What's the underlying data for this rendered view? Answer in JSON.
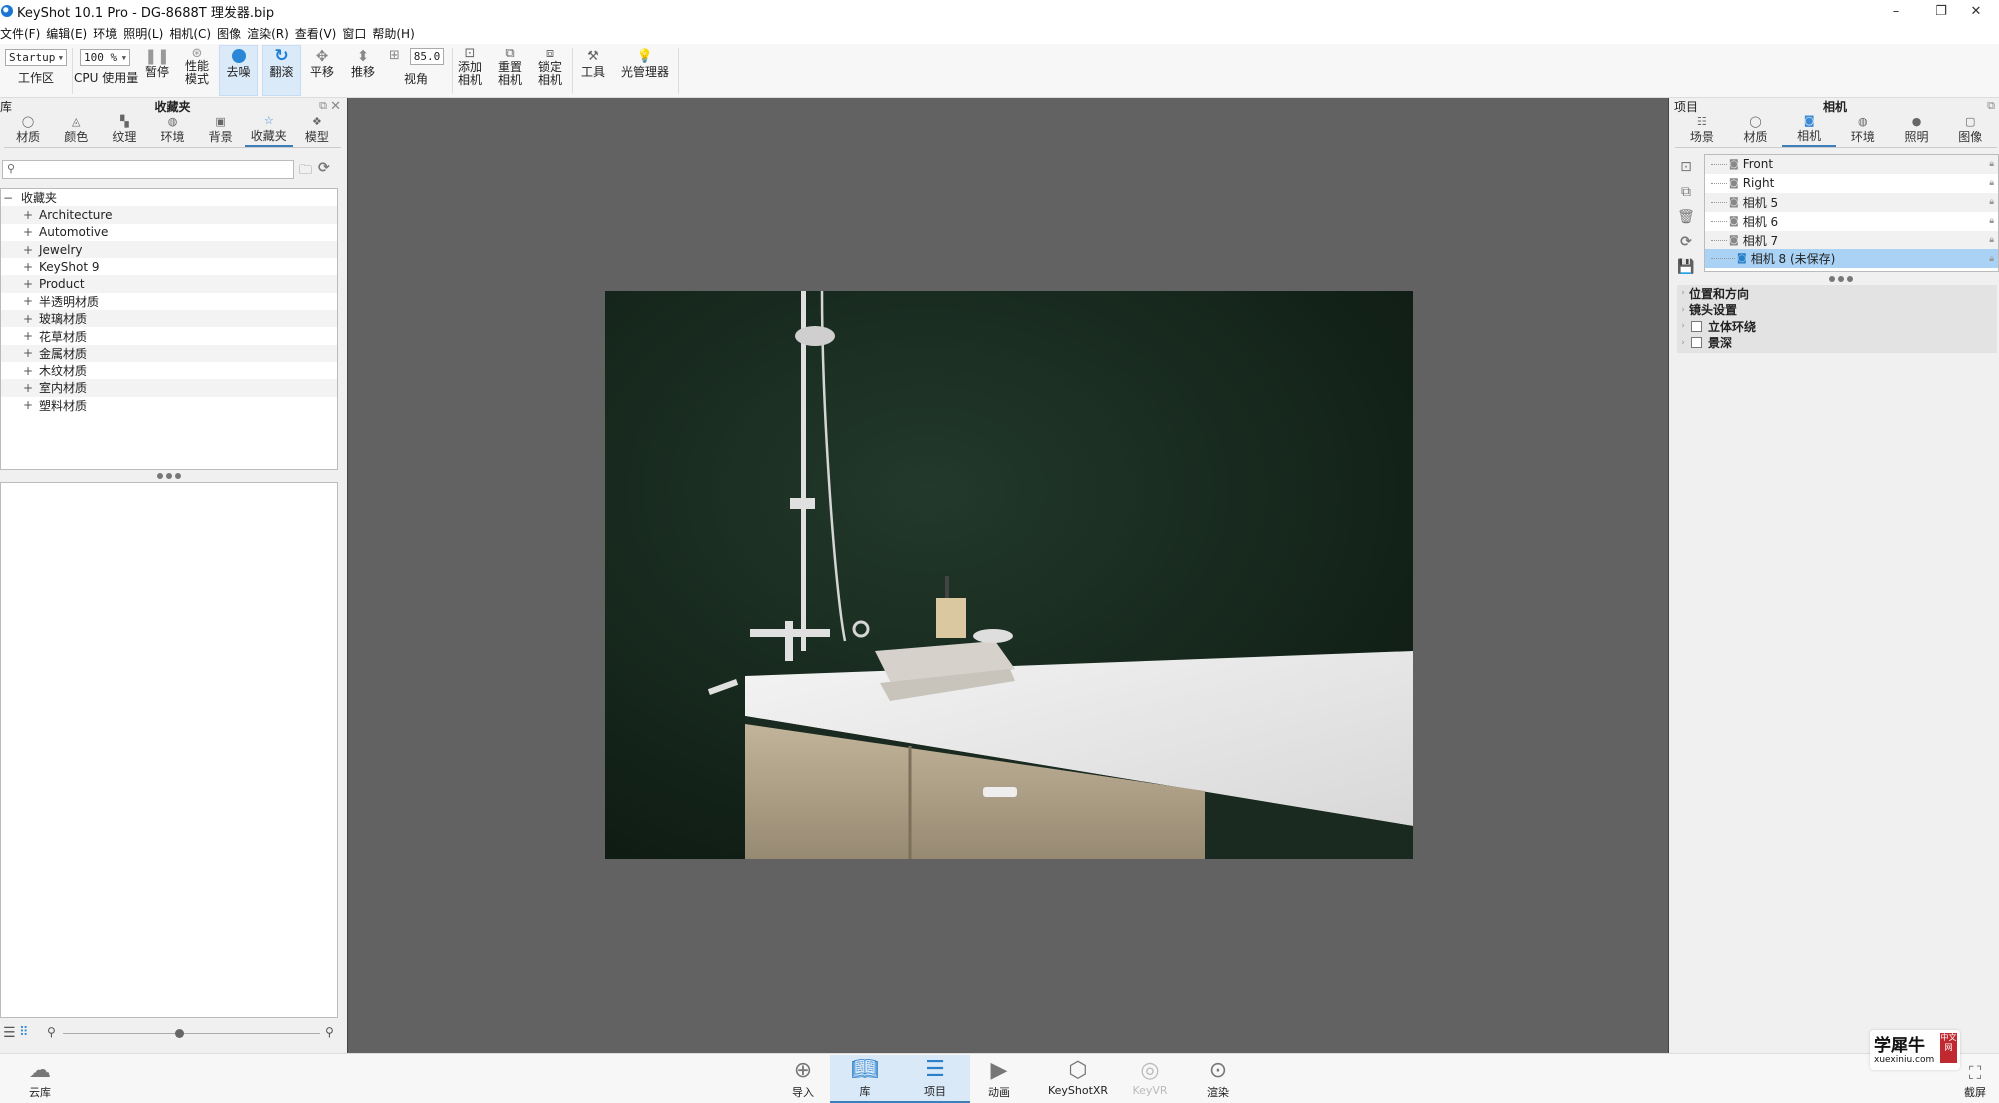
{
  "window": {
    "title": "KeyShot 10.1 Pro  - DG-8688T 理发器.bip",
    "minimize_icon": "–",
    "restore_icon": "❐",
    "close_icon": "✕"
  },
  "menu": [
    "文件(F)",
    "编辑(E)",
    "环境",
    "照明(L)",
    "相机(C)",
    "图像",
    "渲染(R)",
    "查看(V)",
    "窗口",
    "帮助(H)"
  ],
  "toolbar": {
    "workspace_value": "Startup",
    "workspace_label": "工作区",
    "cpu_value": "100 %",
    "cpu_label": "CPU 使用量",
    "pause_label": "暂停",
    "performance_label": "性能\n模式",
    "denoise_label": "去噪",
    "tumble_label": "翻滚",
    "pan_label": "平移",
    "dolly_label": "推移",
    "fov_value": "85.0",
    "fov_label": "视角",
    "add_camera_label": "添加\n相机",
    "reset_camera_label": "重置\n相机",
    "lock_camera_label": "锁定\n相机",
    "tools_label": "工具",
    "light_manager_label": "光管理器"
  },
  "library": {
    "panel_label": "库",
    "title": "收藏夹",
    "tabs": [
      {
        "label": "材质",
        "icon": "material-icon",
        "glyph": "◯"
      },
      {
        "label": "颜色",
        "icon": "color-icon",
        "glyph": "◬"
      },
      {
        "label": "纹理",
        "icon": "texture-icon",
        "glyph": "▚"
      },
      {
        "label": "环境",
        "icon": "environment-icon",
        "glyph": "◍"
      },
      {
        "label": "背景",
        "icon": "background-icon",
        "glyph": "▣"
      },
      {
        "label": "收藏夹",
        "icon": "favorites-icon",
        "glyph": "☆",
        "active": true
      },
      {
        "label": "模型",
        "icon": "model-icon",
        "glyph": "❖"
      }
    ],
    "search_placeholder": "",
    "tree_root": "收藏夹",
    "tree_items": [
      "Architecture",
      "Automotive",
      "Jewelry",
      "KeyShot 9",
      "Product",
      "半透明材质",
      "玻璃材质",
      "花草材质",
      "金属材质",
      "木纹材质",
      "室内材质",
      "塑料材质"
    ],
    "thumbnail_size": 0.45
  },
  "project": {
    "panel_label": "项目",
    "title": "相机",
    "tabs": [
      {
        "label": "场景",
        "icon": "scene-icon",
        "glyph": "☷"
      },
      {
        "label": "材质",
        "icon": "material-icon",
        "glyph": "◯"
      },
      {
        "label": "相机",
        "icon": "camera-icon",
        "glyph": "◙",
        "active": true
      },
      {
        "label": "环境",
        "icon": "environment-icon",
        "glyph": "◍"
      },
      {
        "label": "照明",
        "icon": "lighting-icon",
        "glyph": "●"
      },
      {
        "label": "图像",
        "icon": "image-icon",
        "glyph": "▢"
      }
    ],
    "cameras": [
      {
        "name": "Front"
      },
      {
        "name": "Right"
      },
      {
        "name": "相机 5"
      },
      {
        "name": "相机 6"
      },
      {
        "name": "相机 7"
      },
      {
        "name": "相机 8 (未保存)",
        "selected": true
      }
    ],
    "sections": [
      {
        "label": "位置和方向",
        "checkbox": false
      },
      {
        "label": "镜头设置",
        "checkbox": false
      },
      {
        "label": "立体环绕",
        "checkbox": true,
        "checked": false
      },
      {
        "label": "景深",
        "checkbox": true,
        "checked": false
      }
    ]
  },
  "bottombar": {
    "cloud_library": "云库",
    "items": [
      {
        "label": "导入",
        "icon": "import-icon"
      },
      {
        "label": "库",
        "icon": "library-icon",
        "active": true
      },
      {
        "label": "项目",
        "icon": "project-icon",
        "active": true
      },
      {
        "label": "动画",
        "icon": "animation-icon"
      },
      {
        "label": "KeyShotXR",
        "icon": "keyshotxr-icon"
      },
      {
        "label": "KeyVR",
        "icon": "keyvr-icon",
        "disabled": true
      },
      {
        "label": "渲染",
        "icon": "render-icon"
      }
    ],
    "screenshot_label": "截屏"
  },
  "watermark": {
    "title": "学犀牛",
    "badge": "中文网",
    "url": "xuexiniu.com"
  }
}
